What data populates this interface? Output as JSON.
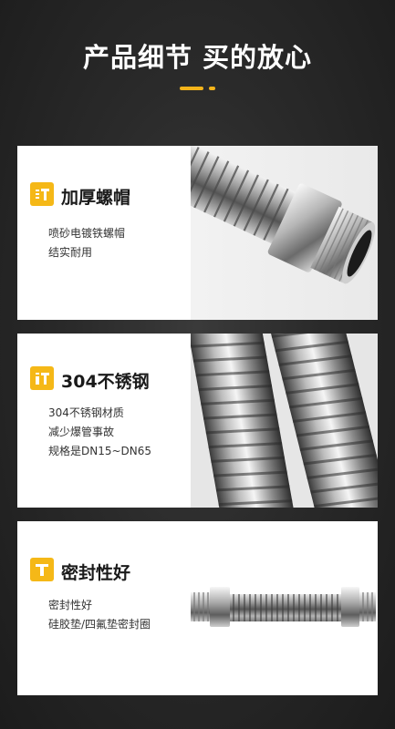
{
  "header": {
    "title": "产品细节 买的放心",
    "accent_color": "#f4b41a"
  },
  "features": [
    {
      "icon": "badge-thick-nut-icon",
      "title": "加厚螺帽",
      "lines": [
        "喷砂电镀铁螺帽",
        "结实耐用"
      ]
    },
    {
      "icon": "badge-steel-icon",
      "title": "304不锈钢",
      "lines": [
        "304不锈钢材质",
        "减少爆管事故",
        "规格是DN15~DN65"
      ]
    },
    {
      "icon": "badge-seal-icon",
      "title": "密封性好",
      "lines": [
        "密封性好",
        "硅胶垫/四氟垫密封圈"
      ]
    }
  ],
  "colors": {
    "background": "#242424",
    "card": "#ffffff",
    "badge": "#f5b817",
    "text_dark": "#1a1a1a"
  }
}
